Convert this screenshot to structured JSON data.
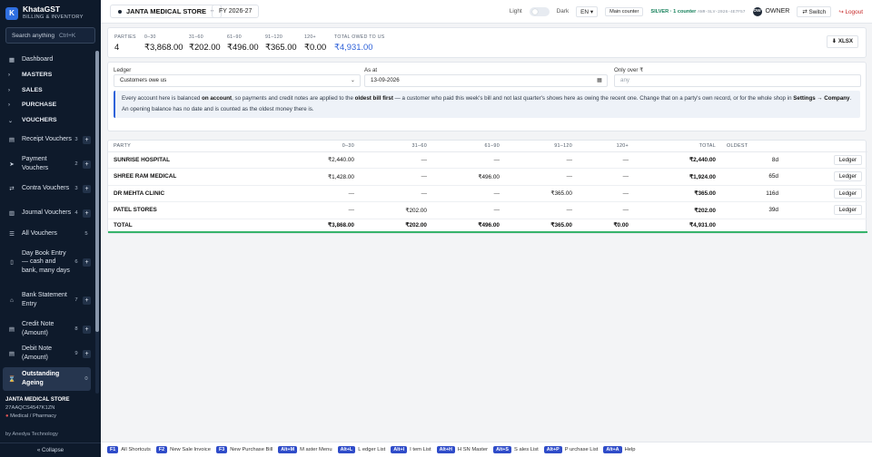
{
  "sidebar": {
    "logo": "K",
    "app_name": "KhataGST",
    "app_sub": "BILLING & INVENTORY",
    "search_placeholder": "Search anything",
    "search_shortcut": "Ctrl+K",
    "dashboard": "Dashboard",
    "groups": {
      "masters": "MASTERS",
      "sales": "SALES",
      "purchase": "PURCHASE",
      "vouchers": "VOUCHERS"
    },
    "voucher_items": [
      {
        "label": "Receipt Vouchers",
        "num": "3"
      },
      {
        "label": "Payment Vouchers",
        "num": "2"
      },
      {
        "label": "Contra Vouchers",
        "num": "3"
      },
      {
        "label": "Journal Vouchers",
        "num": "4"
      },
      {
        "label": "All Vouchers",
        "num": "5"
      },
      {
        "label": "Day Book Entry — cash and bank, many days",
        "num": "6"
      },
      {
        "label": "Bank Statement Entry",
        "num": "7"
      },
      {
        "label": "Credit Note (Amount)",
        "num": "8"
      },
      {
        "label": "Debit Note (Amount)",
        "num": "9"
      },
      {
        "label": "Outstanding Ageing",
        "num": "0"
      }
    ],
    "store_name": "JANTA MEDICAL STORE",
    "gstin": "27AAQCS4547K1ZN",
    "business_type": "Medical / Pharmacy",
    "vendor": "by Anedya Technology",
    "collapse": "« Collapse"
  },
  "topbar": {
    "store": "JANTA MEDICAL STORE",
    "fy": "FY 2026-27",
    "light": "Light",
    "dark": "Dark",
    "lang": "EN",
    "counter": "Main counter",
    "plan": "SILVER · 1 counter",
    "license": "ANR-SLV-2026-4E7F57",
    "avatar": "OW",
    "role": "OWNER",
    "switch": "⇄ Switch",
    "logout": "↪ Logout"
  },
  "summary": {
    "parties": {
      "label": "PARTIES",
      "value": "4"
    },
    "b0_30": {
      "label": "0–30",
      "value": "₹3,868.00"
    },
    "b31_60": {
      "label": "31–60",
      "value": "₹202.00"
    },
    "b61_90": {
      "label": "61–90",
      "value": "₹496.00"
    },
    "b91_120": {
      "label": "91–120",
      "value": "₹365.00"
    },
    "b120p": {
      "label": "120+",
      "value": "₹0.00"
    },
    "total": {
      "label": "TOTAL OWED TO US",
      "value": "₹4,931.00"
    },
    "export": "⬇ XLSX"
  },
  "filters": {
    "ledger_label": "Ledger",
    "ledger_value": "Customers owe us",
    "asat_label": "As at",
    "asat_value": "13-09-2026",
    "over_label": "Only over ₹",
    "over_placeholder": "any"
  },
  "note": {
    "t1": "Every account here is balanced ",
    "b1": "on account",
    "t2": ", so payments and credit notes are applied to the ",
    "b2": "oldest bill first",
    "t3": " — a customer who paid this week's bill and not last quarter's shows here as owing the recent one. Change that on a party's own record, or for the whole shop in ",
    "b3": "Settings → Company",
    "t4": ". An opening balance has no date and is counted as the oldest money there is."
  },
  "table": {
    "headers": [
      "PARTY",
      "0–30",
      "31–60",
      "61–90",
      "91–120",
      "120+",
      "TOTAL",
      "OLDEST",
      ""
    ],
    "rows": [
      {
        "party": "SUNRISE HOSPITAL",
        "b0": "₹2,440.00",
        "b31": "—",
        "b61": "—",
        "b91": "—",
        "b120": "—",
        "total": "₹2,440.00",
        "oldest": "8d",
        "action": "Ledger"
      },
      {
        "party": "SHREE RAM MEDICAL",
        "b0": "₹1,428.00",
        "b31": "—",
        "b61": "₹496.00",
        "b91": "—",
        "b120": "—",
        "total": "₹1,924.00",
        "oldest": "65d",
        "action": "Ledger"
      },
      {
        "party": "DR MEHTA CLINIC",
        "b0": "—",
        "b31": "—",
        "b61": "—",
        "b91": "₹365.00",
        "b120": "—",
        "total": "₹365.00",
        "oldest": "116d",
        "action": "Ledger"
      },
      {
        "party": "PATEL STORES",
        "b0": "—",
        "b31": "₹202.00",
        "b61": "—",
        "b91": "—",
        "b120": "—",
        "total": "₹202.00",
        "oldest": "39d",
        "action": "Ledger"
      }
    ],
    "totals": {
      "label": "TOTAL",
      "b0": "₹3,868.00",
      "b31": "₹202.00",
      "b61": "₹496.00",
      "b91": "₹365.00",
      "b120": "₹0.00",
      "total": "₹4,931.00"
    }
  },
  "shortcuts": [
    {
      "key": "F1",
      "label": "All Shortcuts"
    },
    {
      "key": "F2",
      "label": "New Sale Invoice"
    },
    {
      "key": "F3",
      "label": "New Purchase Bill"
    },
    {
      "key": "Alt+M",
      "label": "M aster Menu"
    },
    {
      "key": "Alt+L",
      "label": "L edger List"
    },
    {
      "key": "Alt+I",
      "label": "I tem List"
    },
    {
      "key": "Alt+H",
      "label": "H SN Master"
    },
    {
      "key": "Alt+S",
      "label": "S ales List"
    },
    {
      "key": "Alt+P",
      "label": "P urchase List"
    },
    {
      "key": "Alt+A",
      "label": "Help"
    }
  ],
  "colors": {
    "sidebar_bg": "#0e1a2b",
    "accent": "#2f62d9",
    "shortcut_key": "#2f4cc9",
    "total_underline": "#36b36a",
    "logout": "#c62828",
    "plan": "#16815b"
  }
}
